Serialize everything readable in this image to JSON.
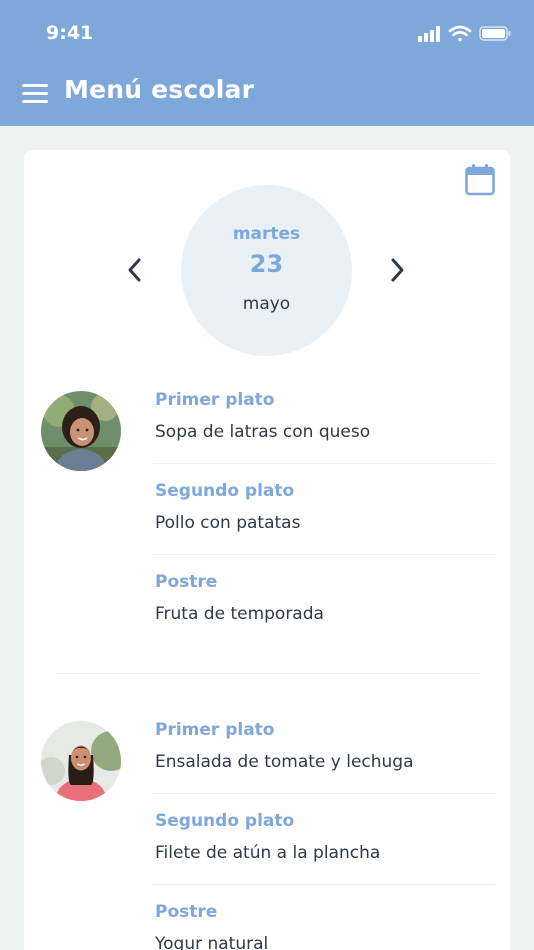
{
  "status_bar": {
    "time": "9:41",
    "icons": [
      "signal-icon",
      "wifi-icon",
      "battery-icon"
    ]
  },
  "header": {
    "menu_icon": "hamburger-menu-icon",
    "title": "Menú escolar",
    "background_color": "#7ea8d9"
  },
  "date_picker": {
    "weekday": "martes",
    "day": "23",
    "month": "mayo",
    "prev_icon": "chevron-left-icon",
    "next_icon": "chevron-right-icon",
    "calendar_icon": "calendar-icon"
  },
  "children": [
    {
      "avatar": "child-photo-boy",
      "courses": [
        {
          "label": "Primer plato",
          "dish": "Sopa de latras con queso"
        },
        {
          "label": "Segundo plato",
          "dish": "Pollo con patatas"
        },
        {
          "label": "Postre",
          "dish": "Fruta de temporada"
        }
      ]
    },
    {
      "avatar": "child-photo-girl",
      "courses": [
        {
          "label": "Primer plato",
          "dish": "Ensalada de tomate y lechuga"
        },
        {
          "label": "Segundo plato",
          "dish": "Filete de atún a la plancha"
        },
        {
          "label": "Postre",
          "dish": "Yogur natural"
        }
      ]
    }
  ],
  "colors": {
    "accent": "#7ea8d9",
    "text": "#2e3a4a",
    "page_background": "#eef3f2",
    "date_circle": "#e9f1f7"
  }
}
